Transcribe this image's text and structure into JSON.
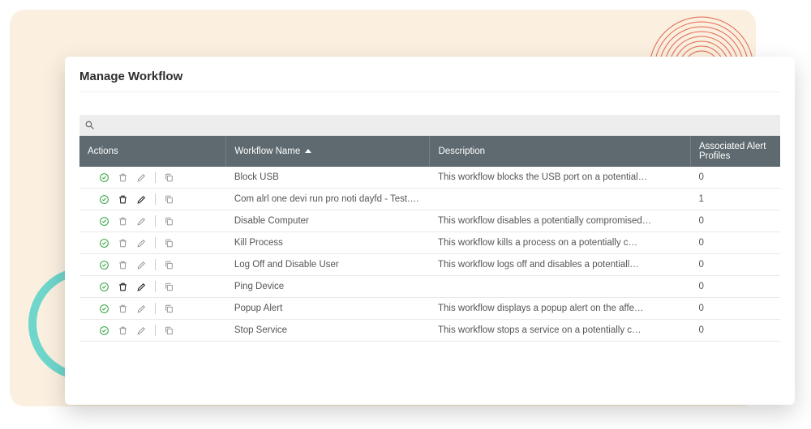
{
  "title": "Manage Workflow",
  "columns": {
    "actions": "Actions",
    "name": "Workflow Name",
    "desc": "Description",
    "assoc": "Associated Alert Profiles"
  },
  "rows": [
    {
      "name": "Block USB",
      "desc": "This workflow blocks the USB port on a potential…",
      "assoc": "0",
      "bold": false
    },
    {
      "name": "Com alrl one devi run pro noti dayfd - Test.bat",
      "desc": "",
      "assoc": "1",
      "bold": true
    },
    {
      "name": "Disable Computer",
      "desc": "This workflow disables a potentially compromised…",
      "assoc": "0",
      "bold": false
    },
    {
      "name": "Kill Process",
      "desc": "This workflow kills a process on a potentially c…",
      "assoc": "0",
      "bold": false
    },
    {
      "name": "Log Off and Disable User",
      "desc": "This workflow logs off and disables a potentiall…",
      "assoc": "0",
      "bold": false
    },
    {
      "name": "Ping Device",
      "desc": "",
      "assoc": "0",
      "bold": true
    },
    {
      "name": "Popup Alert",
      "desc": "This workflow displays a popup alert on the affe…",
      "assoc": "0",
      "bold": false
    },
    {
      "name": "Stop Service",
      "desc": "This workflow stops a service on a potentially c…",
      "assoc": "0",
      "bold": false
    }
  ]
}
